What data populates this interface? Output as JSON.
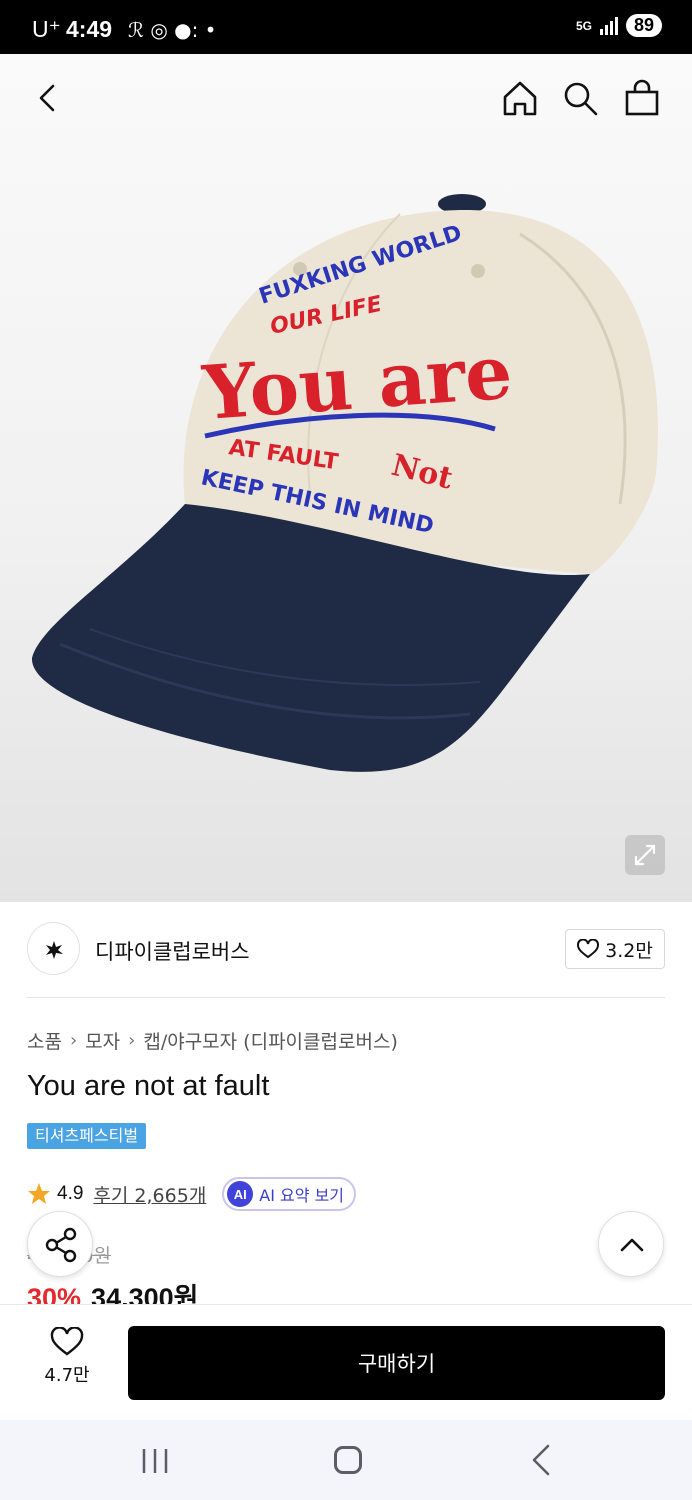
{
  "status_bar": {
    "carrier": "U⁺",
    "time": "4:49",
    "notification_icons": "ℛ ◎ ●: •",
    "network": "5G",
    "battery": "89"
  },
  "product_image": {
    "embroidery": [
      "FUXKING WORLD",
      "OUR LIFE",
      "You are",
      "Not",
      "AT FAULT",
      "KEEP THIS IN MIND"
    ],
    "colors": {
      "crown": "#ece5d6",
      "brim": "#1f2a44",
      "red_thread": "#d8212b",
      "blue_thread": "#2a35b8"
    }
  },
  "brand": {
    "name": "디파이클럽로버스",
    "like_count": "3.2만"
  },
  "breadcrumb": [
    "소품",
    "모자",
    "캡/야구모자 (디파이클럽로버스)"
  ],
  "product": {
    "title": "You are not at fault",
    "tag": "티셔츠페스티벌",
    "rating": "4.9",
    "reviews": "후기 2,665개",
    "ai_badge": "AI",
    "ai_summary": "AI 요약 보기",
    "original_price": "49,000원",
    "discount": "30%",
    "price": "34,300원"
  },
  "bottom_bar": {
    "wish_count": "4.7만",
    "buy_label": "구매하기"
  },
  "colors": {
    "accent_red": "#e4282b",
    "tag_blue": "#4aa3e2",
    "ai_purple": "#3f43d9",
    "buy_black": "#000000"
  }
}
